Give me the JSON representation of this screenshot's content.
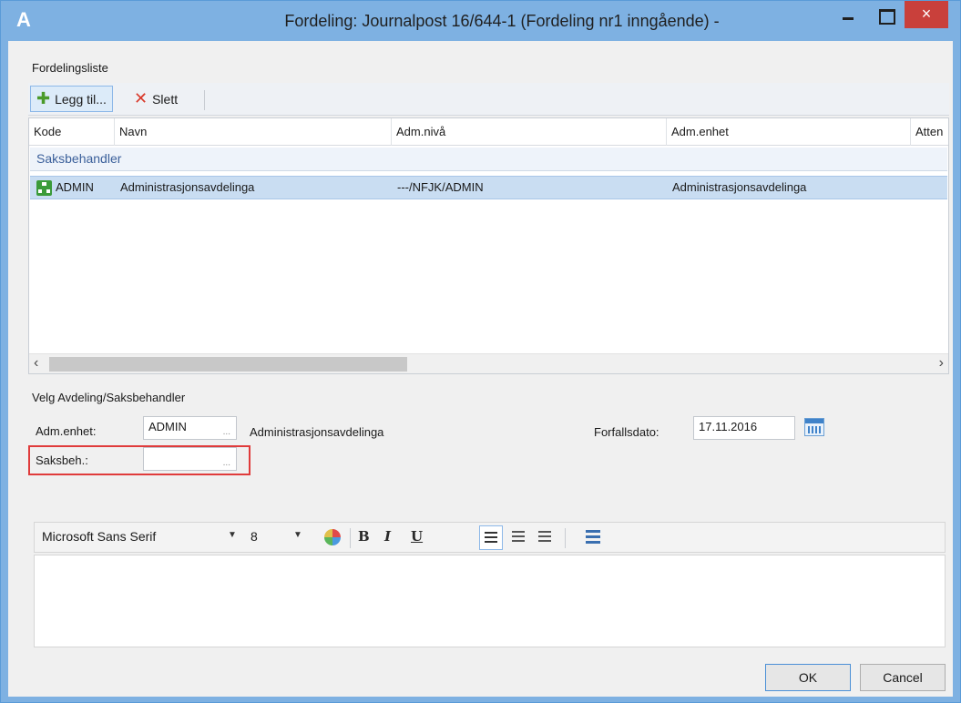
{
  "window": {
    "app_icon_glyph": "A",
    "title": "Fordeling: Journalpost 16/644-1 (Fordeling nr1 inngående) -",
    "close_glyph": "×"
  },
  "distribution_list": {
    "group_label": "Fordelingsliste",
    "toolbar": {
      "add_label": "Legg til...",
      "delete_label": "Slett"
    },
    "columns": [
      "Kode",
      "Navn",
      "Adm.nivå",
      "Adm.enhet",
      "Atten"
    ],
    "group_row": "Saksbehandler",
    "rows": [
      {
        "kode": "ADMIN",
        "navn": "Administrasjonsavdelinga",
        "adm_niva": "---/NFJK/ADMIN",
        "adm_enhet": "Administrasjonsavdelinga"
      }
    ]
  },
  "selection": {
    "group_label": "Velg Avdeling/Saksbehandler",
    "adm_enhet_label": "Adm.enhet:",
    "adm_enhet_value": "ADMIN",
    "adm_enhet_name": "Administrasjonsavdelinga",
    "saksbeh_label": "Saksbeh.:",
    "saksbeh_value": "",
    "lookup_dots": "...",
    "due_date_label": "Forfallsdato:",
    "due_date_value": "17.11.2016"
  },
  "editor_toolbar": {
    "font": "Microsoft Sans Serif",
    "size": "8",
    "bold": "B",
    "italic": "I",
    "underline": "U"
  },
  "buttons": {
    "ok": "OK",
    "cancel": "Cancel"
  }
}
